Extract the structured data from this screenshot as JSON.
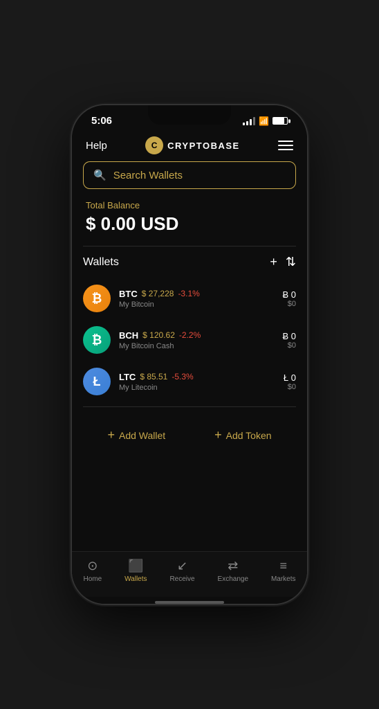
{
  "status_bar": {
    "time": "5:06"
  },
  "header": {
    "help_label": "Help",
    "logo_icon": "C",
    "logo_text": "CRYPTOBASE",
    "menu_icon": "hamburger"
  },
  "search": {
    "placeholder": "Search Wallets"
  },
  "balance": {
    "label": "Total Balance",
    "amount": "$ 0.00 USD"
  },
  "wallets": {
    "section_label": "Wallets",
    "add_icon": "+",
    "sort_icon": "⇅",
    "items": [
      {
        "symbol": "BTC",
        "price": "$ 27,228",
        "change": "-3.1%",
        "name": "My Bitcoin",
        "balance": "Ƀ 0",
        "usd": "$0",
        "type": "btc",
        "icon_text": "₿"
      },
      {
        "symbol": "BCH",
        "price": "$ 120.62",
        "change": "-2.2%",
        "name": "My Bitcoin Cash",
        "balance": "Ƀ 0",
        "usd": "$0",
        "type": "bch",
        "icon_text": "₿"
      },
      {
        "symbol": "LTC",
        "price": "$ 85.51",
        "change": "-5.3%",
        "name": "My Litecoin",
        "balance": "Ł 0",
        "usd": "$0",
        "type": "ltc",
        "icon_text": "Ł"
      }
    ],
    "add_wallet_label": "Add Wallet",
    "add_token_label": "Add Token"
  },
  "bottom_nav": {
    "items": [
      {
        "icon": "⊙",
        "label": "Home",
        "active": false
      },
      {
        "icon": "▭",
        "label": "Wallets",
        "active": true
      },
      {
        "icon": "↙",
        "label": "Receive",
        "active": false
      },
      {
        "icon": "⇄",
        "label": "Exchange",
        "active": false
      },
      {
        "icon": "≡",
        "label": "Markets",
        "active": false
      }
    ]
  }
}
